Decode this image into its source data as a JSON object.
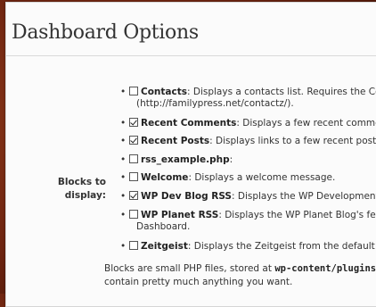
{
  "page_title": "Dashboard Options",
  "blocks_label_line1": "Blocks to",
  "blocks_label_line2": "display:",
  "items": [
    {
      "name": "Contacts",
      "checked": false,
      "desc": ": Displays a contacts list. Requires the Con",
      "desc2": "(http://familypress.net/contactz/)."
    },
    {
      "name": "Recent Comments",
      "checked": true,
      "desc": ": Displays a few recent commen"
    },
    {
      "name": "Recent Posts",
      "checked": true,
      "desc": ": Displays links to a few recent posts."
    },
    {
      "name": "rss_example.php",
      "checked": false,
      "desc": ":"
    },
    {
      "name": "Welcome",
      "checked": false,
      "desc": ": Displays a welcome message."
    },
    {
      "name": "WP Dev Blog RSS",
      "checked": true,
      "desc": ": Displays the WP Development Bl"
    },
    {
      "name": "WP Planet RSS",
      "checked": false,
      "desc": ": Displays the WP Planet Blog's feed, ",
      "desc2": "Dashboard."
    },
    {
      "name": "Zeitgeist",
      "checked": false,
      "desc": ": Displays the Zeitgeist from the default D"
    }
  ],
  "footer_line1_pre": "Blocks are small PHP files, stored at ",
  "footer_line1_code": "wp-content/plugins/c",
  "footer_line2": "contain pretty much anything you want."
}
